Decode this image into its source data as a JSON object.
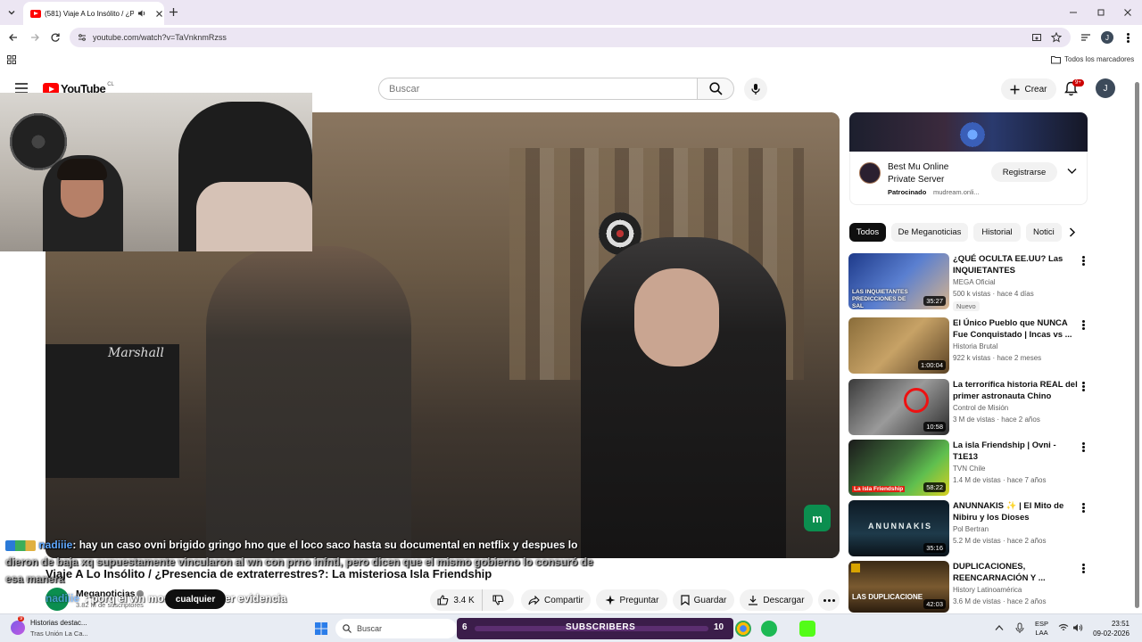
{
  "browser": {
    "tab_title": "(581) Viaje A Lo Insólito / ¿P",
    "url": "youtube.com/watch?v=TaVnknmRzss",
    "bookmarks_label": "Todos los marcadores",
    "profile_initial": "J"
  },
  "header": {
    "logo_text": "YouTube",
    "country": "CL",
    "search_placeholder": "Buscar",
    "create_label": "Crear",
    "notif_count": "9+",
    "avatar_initial": "J"
  },
  "video": {
    "title": "Viaje A Lo Insólito / ¿Presencia de extraterrestres?: La misteriosa Isla Friendship",
    "channel": "Meganoticias",
    "subscribers": "3.82 M de suscriptores",
    "likes": "3.4 K",
    "share": "Compartir",
    "ask": "Preguntar",
    "save": "Guardar",
    "download": "Descargar",
    "subscribe_overlay": "cualquier",
    "scene_text": "Marshall"
  },
  "chat_overlay": {
    "line1_user": "nadiiie",
    "line1_text": ": hay un caso ovni brigido gringo hno que el loco saco hasta su documental en netflix y despues lo",
    "line2_text": "dieron de baja xq supuestamente vincularon al wn con prno infntl, pero dicen que el mismo gobierno lo consuró de",
    "line3_text": "esa manera",
    "line4_user": "nadiiie",
    "line4_text": ": porq el wn mostró cualquier evidencia"
  },
  "sidebar": {
    "ad": {
      "title": "Best Mu Online Private Server",
      "sponsored": "Patrocinado",
      "domain": "mudream.onli...",
      "cta": "Registrarse"
    },
    "chips": [
      "Todos",
      "De Meganoticias",
      "Historial",
      "Notici"
    ],
    "recommendations": [
      {
        "title": "¿QUÉ OCULTA EE.UU? Las INQUIETANTES PREDICCIONE...",
        "channel": "MEGA Oficial",
        "meta": "500 k vistas · hace 4 días",
        "badge": "Nuevo",
        "duration": "35:27",
        "thumb_text": "LAS INQUIETANTES PREDICCIONES DE SAL"
      },
      {
        "title": "El Único Pueblo que NUNCA Fue Conquistado | Incas vs ...",
        "channel": "Historia Brutal",
        "meta": "922 k vistas · hace 2 meses",
        "badge": "",
        "duration": "1:00:04",
        "thumb_text": ""
      },
      {
        "title": "La terrorífica historia REAL del primer astronauta Chino",
        "channel": "Control de Misión",
        "meta": "3 M de vistas · hace 2 años",
        "badge": "",
        "duration": "10:58",
        "thumb_text": ""
      },
      {
        "title": "La isla Friendship | Ovni - T1E13",
        "channel": "TVN Chile",
        "meta": "1.4 M de vistas · hace 7 años",
        "badge": "",
        "duration": "58:22",
        "thumb_text": "La isla Friendship"
      },
      {
        "title": "ANUNNAKIS ✨ | El Mito de Nibiru y los Dioses Astronauta...",
        "channel": "Pol Bertran",
        "meta": "5.2 M de vistas · hace 2 años",
        "badge": "",
        "duration": "35:16",
        "thumb_text": "ANUNNAKIS"
      },
      {
        "title": "DUPLICACIONES, REENCARNACIÓN Y ...",
        "channel": "History Latinoamérica",
        "meta": "3.6 M de vistas · hace 2 años",
        "badge": "",
        "duration": "42:03",
        "thumb_text": "LAS DUPLICACIONE"
      }
    ]
  },
  "taskbar": {
    "news_title": "Historias destac...",
    "news_sub": "Tras Unión La Ca...",
    "news_count": "9",
    "search_label": "Buscar",
    "widget_left": "6",
    "widget_text": "SUBSCRIBERS",
    "widget_right": "10",
    "lang_top": "ESP",
    "lang_bottom": "LAA",
    "time": "23:51",
    "date": "09-02-2026"
  },
  "colors": {
    "yt_red": "#ff0000",
    "accent_blue": "#065fd4",
    "chrome_bg": "#ece6f3"
  }
}
